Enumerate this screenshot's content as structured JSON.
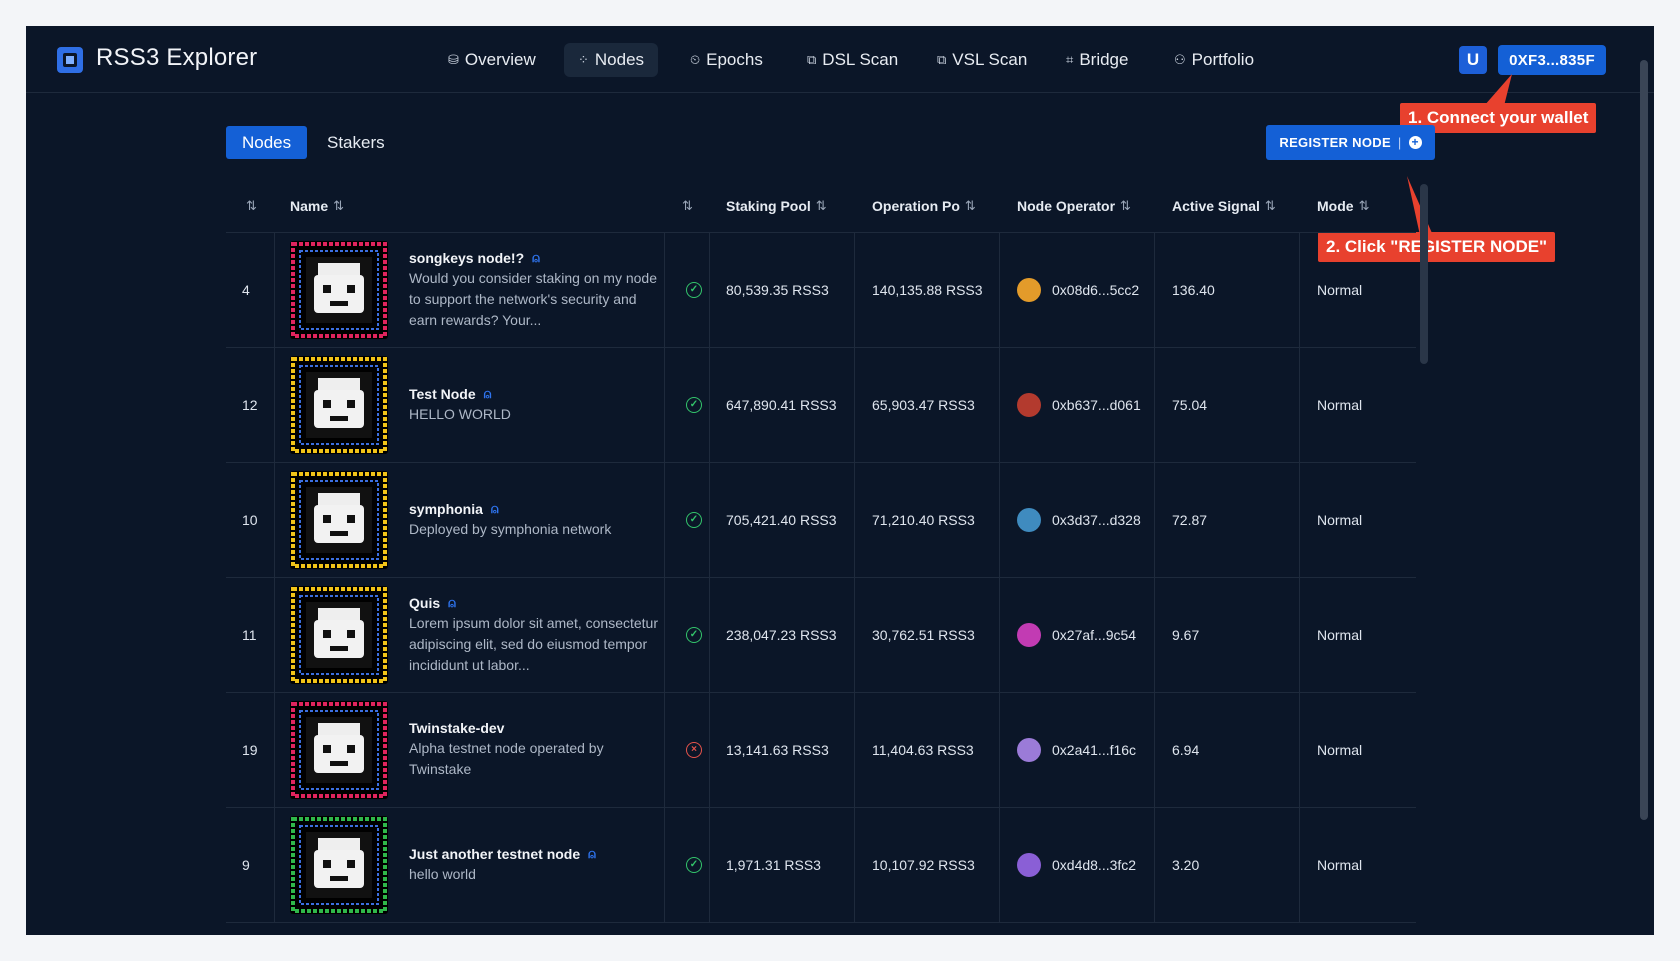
{
  "header": {
    "brand": "RSS3 Explorer",
    "nav": [
      {
        "label": "Overview",
        "icon": "⛁"
      },
      {
        "label": "Nodes",
        "icon": "⁘"
      },
      {
        "label": "Epochs",
        "icon": "⏲"
      },
      {
        "label": "DSL Scan",
        "icon": "⧉"
      },
      {
        "label": "VSL Scan",
        "icon": "⧉"
      },
      {
        "label": "Bridge",
        "icon": "⌗"
      },
      {
        "label": "Portfolio",
        "icon": "⚇"
      }
    ],
    "active_nav": "Nodes",
    "wallet_address": "0XF3...835F",
    "wallet_icon_letter": "U"
  },
  "annotations": {
    "step1": "1. Connect your wallet",
    "step2": "2. Click \"REGISTER NODE\"",
    "color": "#e8412e"
  },
  "tabs": {
    "nodes": "Nodes",
    "stakers": "Stakers"
  },
  "register": {
    "label": "REGISTER NODE",
    "sep": "|"
  },
  "table": {
    "sort_icon": "⇅",
    "columns": {
      "name": "Name",
      "staking_pool": "Staking Pool",
      "operation_pool": "Operation Po",
      "node_operator": "Node Operator",
      "active_signal": "Active Signal",
      "mode": "Mode"
    },
    "rows": [
      {
        "id": "4",
        "name": "songkeys node!?",
        "verified": true,
        "desc": "Would you consider staking on my node to support the network's security and earn rewards? Your...",
        "status": "ok",
        "staking": "80,539.35 RSS3",
        "operation": "140,135.88 RSS3",
        "operator": "0x08d6...5cc2",
        "op_color": "#e39b2a",
        "signal": "136.40",
        "mode": "Normal",
        "frame": "#e0245e"
      },
      {
        "id": "12",
        "name": "Test Node",
        "verified": true,
        "desc": "HELLO WORLD",
        "status": "ok",
        "staking": "647,890.41 RSS3",
        "operation": "65,903.47 RSS3",
        "operator": "0xb637...d061",
        "op_color": "#b33a2e",
        "signal": "75.04",
        "mode": "Normal",
        "frame": "#f2c418"
      },
      {
        "id": "10",
        "name": "symphonia",
        "verified": true,
        "desc": "Deployed by symphonia network",
        "status": "ok",
        "staking": "705,421.40 RSS3",
        "operation": "71,210.40 RSS3",
        "operator": "0x3d37...d328",
        "op_color": "#3f8bbf",
        "signal": "72.87",
        "mode": "Normal",
        "frame": "#f2c418"
      },
      {
        "id": "11",
        "name": "Quis",
        "verified": true,
        "desc": "Lorem ipsum dolor sit amet, consectetur adipiscing elit, sed do eiusmod tempor incididunt ut labor...",
        "status": "ok",
        "staking": "238,047.23 RSS3",
        "operation": "30,762.51 RSS3",
        "operator": "0x27af...9c54",
        "op_color": "#c23bb3",
        "signal": "9.67",
        "mode": "Normal",
        "frame": "#f2c418"
      },
      {
        "id": "19",
        "name": "Twinstake-dev",
        "verified": false,
        "desc": "Alpha testnet node operated by Twinstake",
        "status": "bad",
        "staking": "13,141.63 RSS3",
        "operation": "11,404.63 RSS3",
        "operator": "0x2a41...f16c",
        "op_color": "#9b7bd8",
        "signal": "6.94",
        "mode": "Normal",
        "frame": "#e0245e"
      },
      {
        "id": "9",
        "name": "Just another testnet node",
        "verified": true,
        "desc": "hello world",
        "status": "ok",
        "staking": "1,971.31 RSS3",
        "operation": "10,107.92 RSS3",
        "operator": "0xd4d8...3fc2",
        "op_color": "#8a5fd6",
        "signal": "3.20",
        "mode": "Normal",
        "frame": "#2fb84a"
      }
    ]
  }
}
